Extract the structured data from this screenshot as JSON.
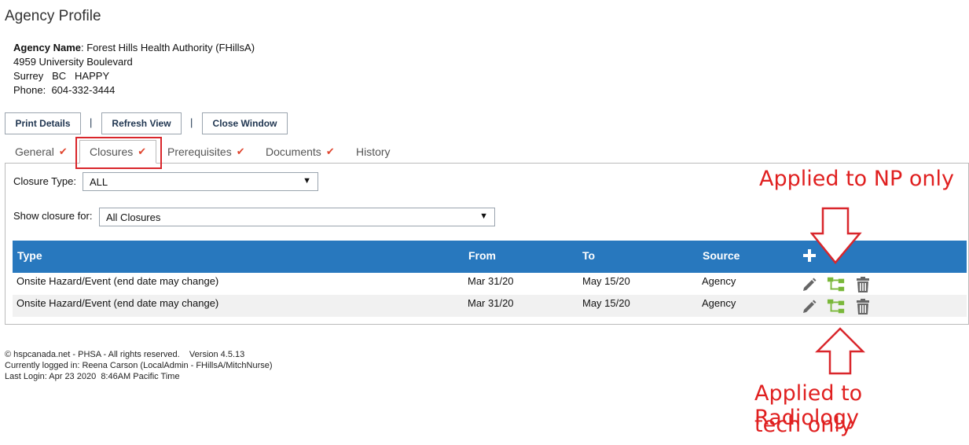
{
  "page": {
    "title": "Agency Profile"
  },
  "agency": {
    "name_label": "Agency Name",
    "name_value": ": Forest Hills Health Authority (FHillsA)",
    "address": "4959 University Boulevard",
    "city": "Surrey",
    "province": "BC",
    "postal": "HAPPY",
    "phone_label": "Phone:",
    "phone": "604-332-3444"
  },
  "toolbar": {
    "print_label": "Print Details",
    "refresh_label": "Refresh View",
    "close_label": "Close Window",
    "separator": "|"
  },
  "tabs": [
    {
      "label": "General",
      "checked": true
    },
    {
      "label": "Closures",
      "checked": true,
      "active": true
    },
    {
      "label": "Prerequisites",
      "checked": true
    },
    {
      "label": "Documents",
      "checked": true
    },
    {
      "label": "History",
      "checked": false
    }
  ],
  "filters": {
    "closure_type_label": "Closure Type:",
    "closure_type_value": "ALL",
    "show_for_label": "Show closure for:",
    "show_for_value": "All Closures"
  },
  "table": {
    "columns": [
      "Type",
      "From",
      "To",
      "Source"
    ],
    "rows": [
      {
        "type": "Onsite Hazard/Event (end date may change)",
        "from": "Mar 31/20",
        "to": "May 15/20",
        "source": "Agency"
      },
      {
        "type": "Onsite Hazard/Event (end date may change)",
        "from": "Mar 31/20",
        "to": "May 15/20",
        "source": "Agency"
      }
    ]
  },
  "footer": {
    "line1": "© hspcanada.net - PHSA - All rights reserved.    Version 4.5.13",
    "line2": "Currently logged in: Reena Carson (LocalAdmin - FHillsA/MitchNurse)",
    "line3": "Last Login: Apr 23 2020  8:46AM Pacific Time"
  },
  "annotations": {
    "np_note": "Applied to NP only",
    "radiology_note_1": "Applied to Radiology",
    "radiology_note_2": "tech only"
  },
  "colors": {
    "header_blue": "#2878be",
    "check_red": "#e0452e",
    "annotation_red": "#e02020",
    "tree_green": "#7ab83a"
  },
  "icons": [
    "check-icon",
    "dropdown-arrow-icon",
    "add-icon",
    "edit-pencil-icon",
    "hierarchy-icon",
    "trash-icon",
    "arrow-down-icon",
    "arrow-up-icon"
  ]
}
